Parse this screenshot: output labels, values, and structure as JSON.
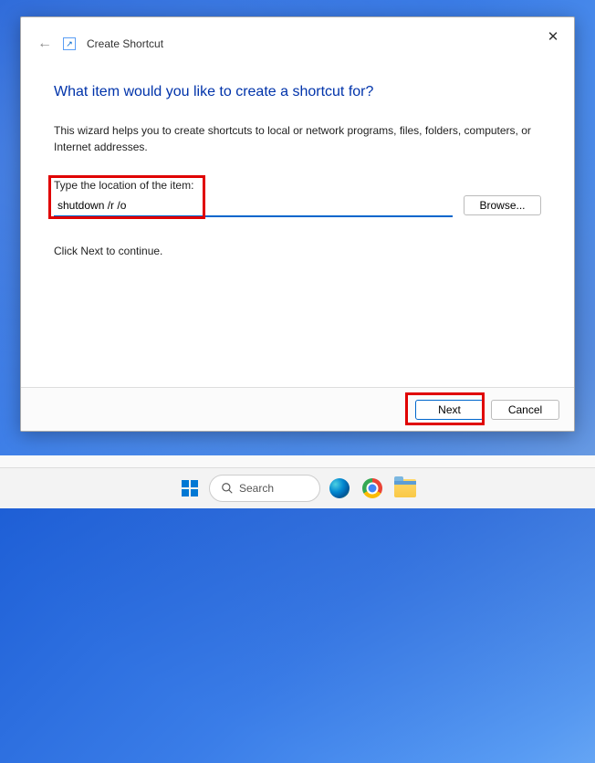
{
  "dialog": {
    "header_title": "Create Shortcut",
    "main_title": "What item would you like to create a shortcut for?",
    "description": "This wizard helps you to create shortcuts to local or network programs, files, folders, computers, or Internet addresses.",
    "input_label": "Type the location of the item:",
    "input_value": "shutdown /r /o",
    "browse_label": "Browse...",
    "continue_text": "Click Next to continue.",
    "next_label": "Next",
    "cancel_label": "Cancel"
  },
  "taskbar": {
    "search_placeholder": "Search"
  }
}
